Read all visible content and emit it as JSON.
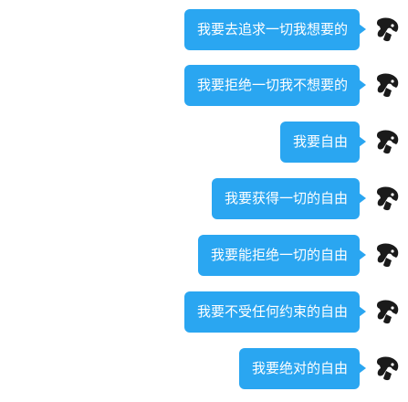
{
  "messages": [
    {
      "text": "我要去追求一切我想要的"
    },
    {
      "text": "我要拒绝一切我不想要的"
    },
    {
      "text": "我要自由"
    },
    {
      "text": "我要获得一切的自由"
    },
    {
      "text": "我要能拒绝一切的自由"
    },
    {
      "text": "我要不受任何约束的自由"
    },
    {
      "text": "我要绝对的自由"
    }
  ],
  "colors": {
    "bubble": "#2aa6f1",
    "bubble_text": "#ffffff",
    "background": "#ffffff",
    "avatar": "#1a1a1a"
  },
  "icons": {
    "avatar": "sender-avatar-icon"
  }
}
